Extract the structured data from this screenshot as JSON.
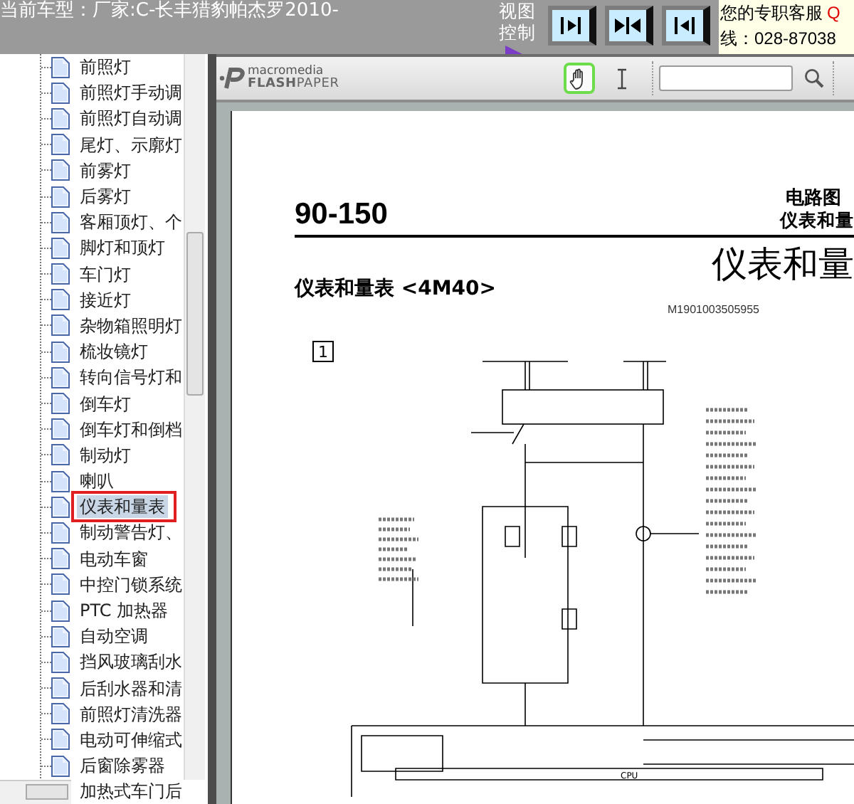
{
  "top_bar": {
    "title": "当前车型：厂家:C-长丰猎豹帕杰罗2010-",
    "view_label": "视图控制",
    "view_buttons": [
      {
        "kind": "expand-right"
      },
      {
        "kind": "split"
      },
      {
        "kind": "collapse-left"
      }
    ],
    "service": {
      "line_1": "您的专职客服",
      "link": "Q",
      "line_2": "线：028-87038"
    }
  },
  "sidebar": {
    "items": [
      {
        "label": "前照灯",
        "selected": false
      },
      {
        "label": "前照灯手动调",
        "selected": false
      },
      {
        "label": "前照灯自动调",
        "selected": false
      },
      {
        "label": "尾灯、示廓灯",
        "selected": false
      },
      {
        "label": "前雾灯",
        "selected": false
      },
      {
        "label": "后雾灯",
        "selected": false
      },
      {
        "label": "客厢顶灯、个",
        "selected": false
      },
      {
        "label": "脚灯和顶灯",
        "selected": false
      },
      {
        "label": "车门灯",
        "selected": false
      },
      {
        "label": "接近灯",
        "selected": false
      },
      {
        "label": "杂物箱照明灯",
        "selected": false
      },
      {
        "label": "梳妆镜灯",
        "selected": false
      },
      {
        "label": "转向信号灯和",
        "selected": false
      },
      {
        "label": "倒车灯",
        "selected": false
      },
      {
        "label": "倒车灯和倒档",
        "selected": false
      },
      {
        "label": "制动灯",
        "selected": false
      },
      {
        "label": "喇叭",
        "selected": false
      },
      {
        "label": "仪表和量表",
        "selected": true
      },
      {
        "label": "制动警告灯、",
        "selected": false
      },
      {
        "label": "电动车窗",
        "selected": false
      },
      {
        "label": "中控门锁系统",
        "selected": false
      },
      {
        "label": "PTC 加热器",
        "selected": false
      },
      {
        "label": "自动空调",
        "selected": false
      },
      {
        "label": "挡风玻璃刮水",
        "selected": false
      },
      {
        "label": "后刮水器和清",
        "selected": false
      },
      {
        "label": "前照灯清洗器",
        "selected": false
      },
      {
        "label": "电动可伸缩式",
        "selected": false
      },
      {
        "label": "后窗除雾器",
        "selected": false
      },
      {
        "label": "加热式车门后",
        "selected": false
      }
    ]
  },
  "viewer": {
    "toolbar": {
      "logo_top": "macromedia",
      "logo_bold": "FLASH",
      "logo_light": "PAPER",
      "tools": [
        {
          "kind": "hand",
          "selected": true
        },
        {
          "kind": "text",
          "selected": false
        }
      ]
    },
    "page": {
      "page_number": "90-150",
      "section": "电路图",
      "subsection": "仪表和量",
      "title": "仪表和量",
      "subtitle": "仪表和量表 <4M40>",
      "code": "M1901003505955",
      "diagram": {
        "box_label": "1",
        "cpu_label": "CPU"
      }
    }
  }
}
